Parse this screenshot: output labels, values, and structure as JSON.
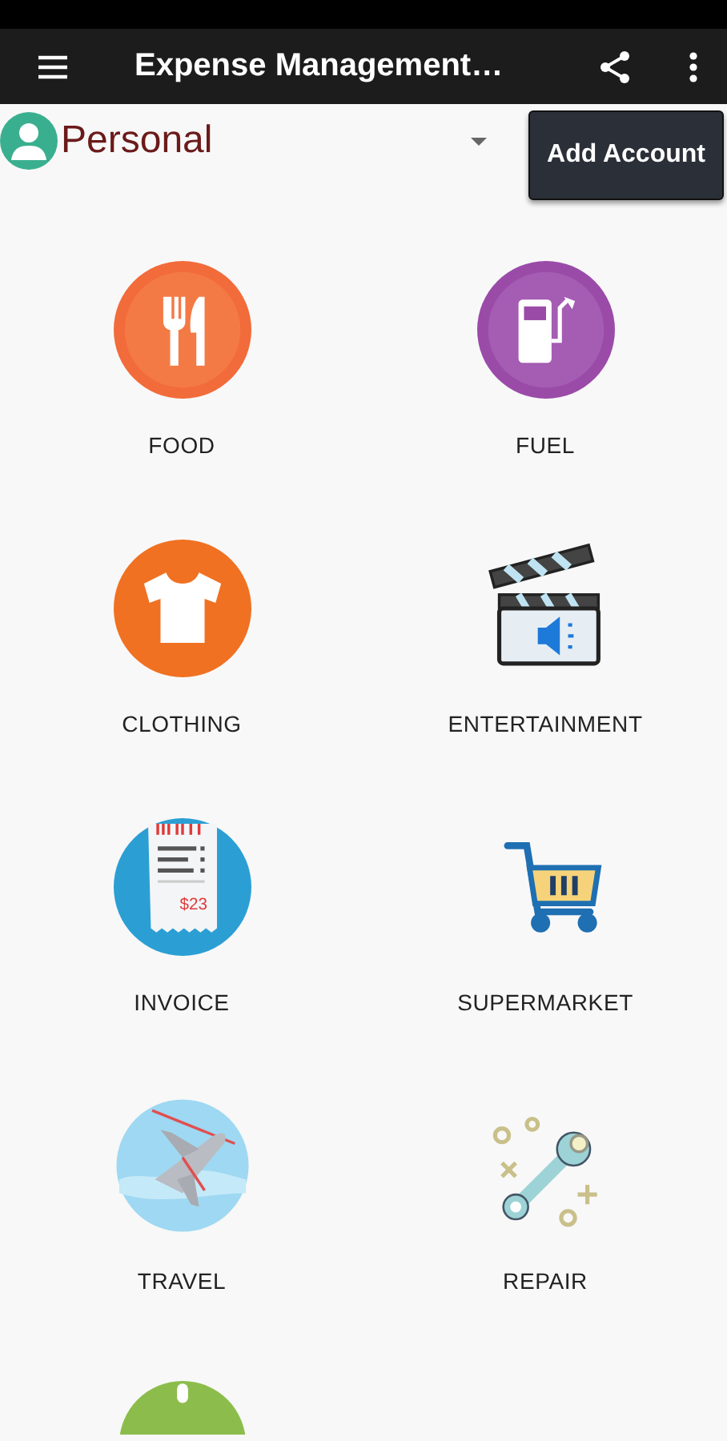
{
  "app_bar": {
    "title": "Expense Management…"
  },
  "account": {
    "name": "Personal",
    "button": "Add Account"
  },
  "categories": [
    {
      "label": "FOOD"
    },
    {
      "label": "FUEL"
    },
    {
      "label": "CLOTHING"
    },
    {
      "label": "ENTERTAINMENT"
    },
    {
      "label": "INVOICE",
      "amount": "$23"
    },
    {
      "label": "SUPERMARKET"
    },
    {
      "label": "TRAVEL"
    },
    {
      "label": "REPAIR"
    },
    {
      "kind": "partial"
    }
  ]
}
